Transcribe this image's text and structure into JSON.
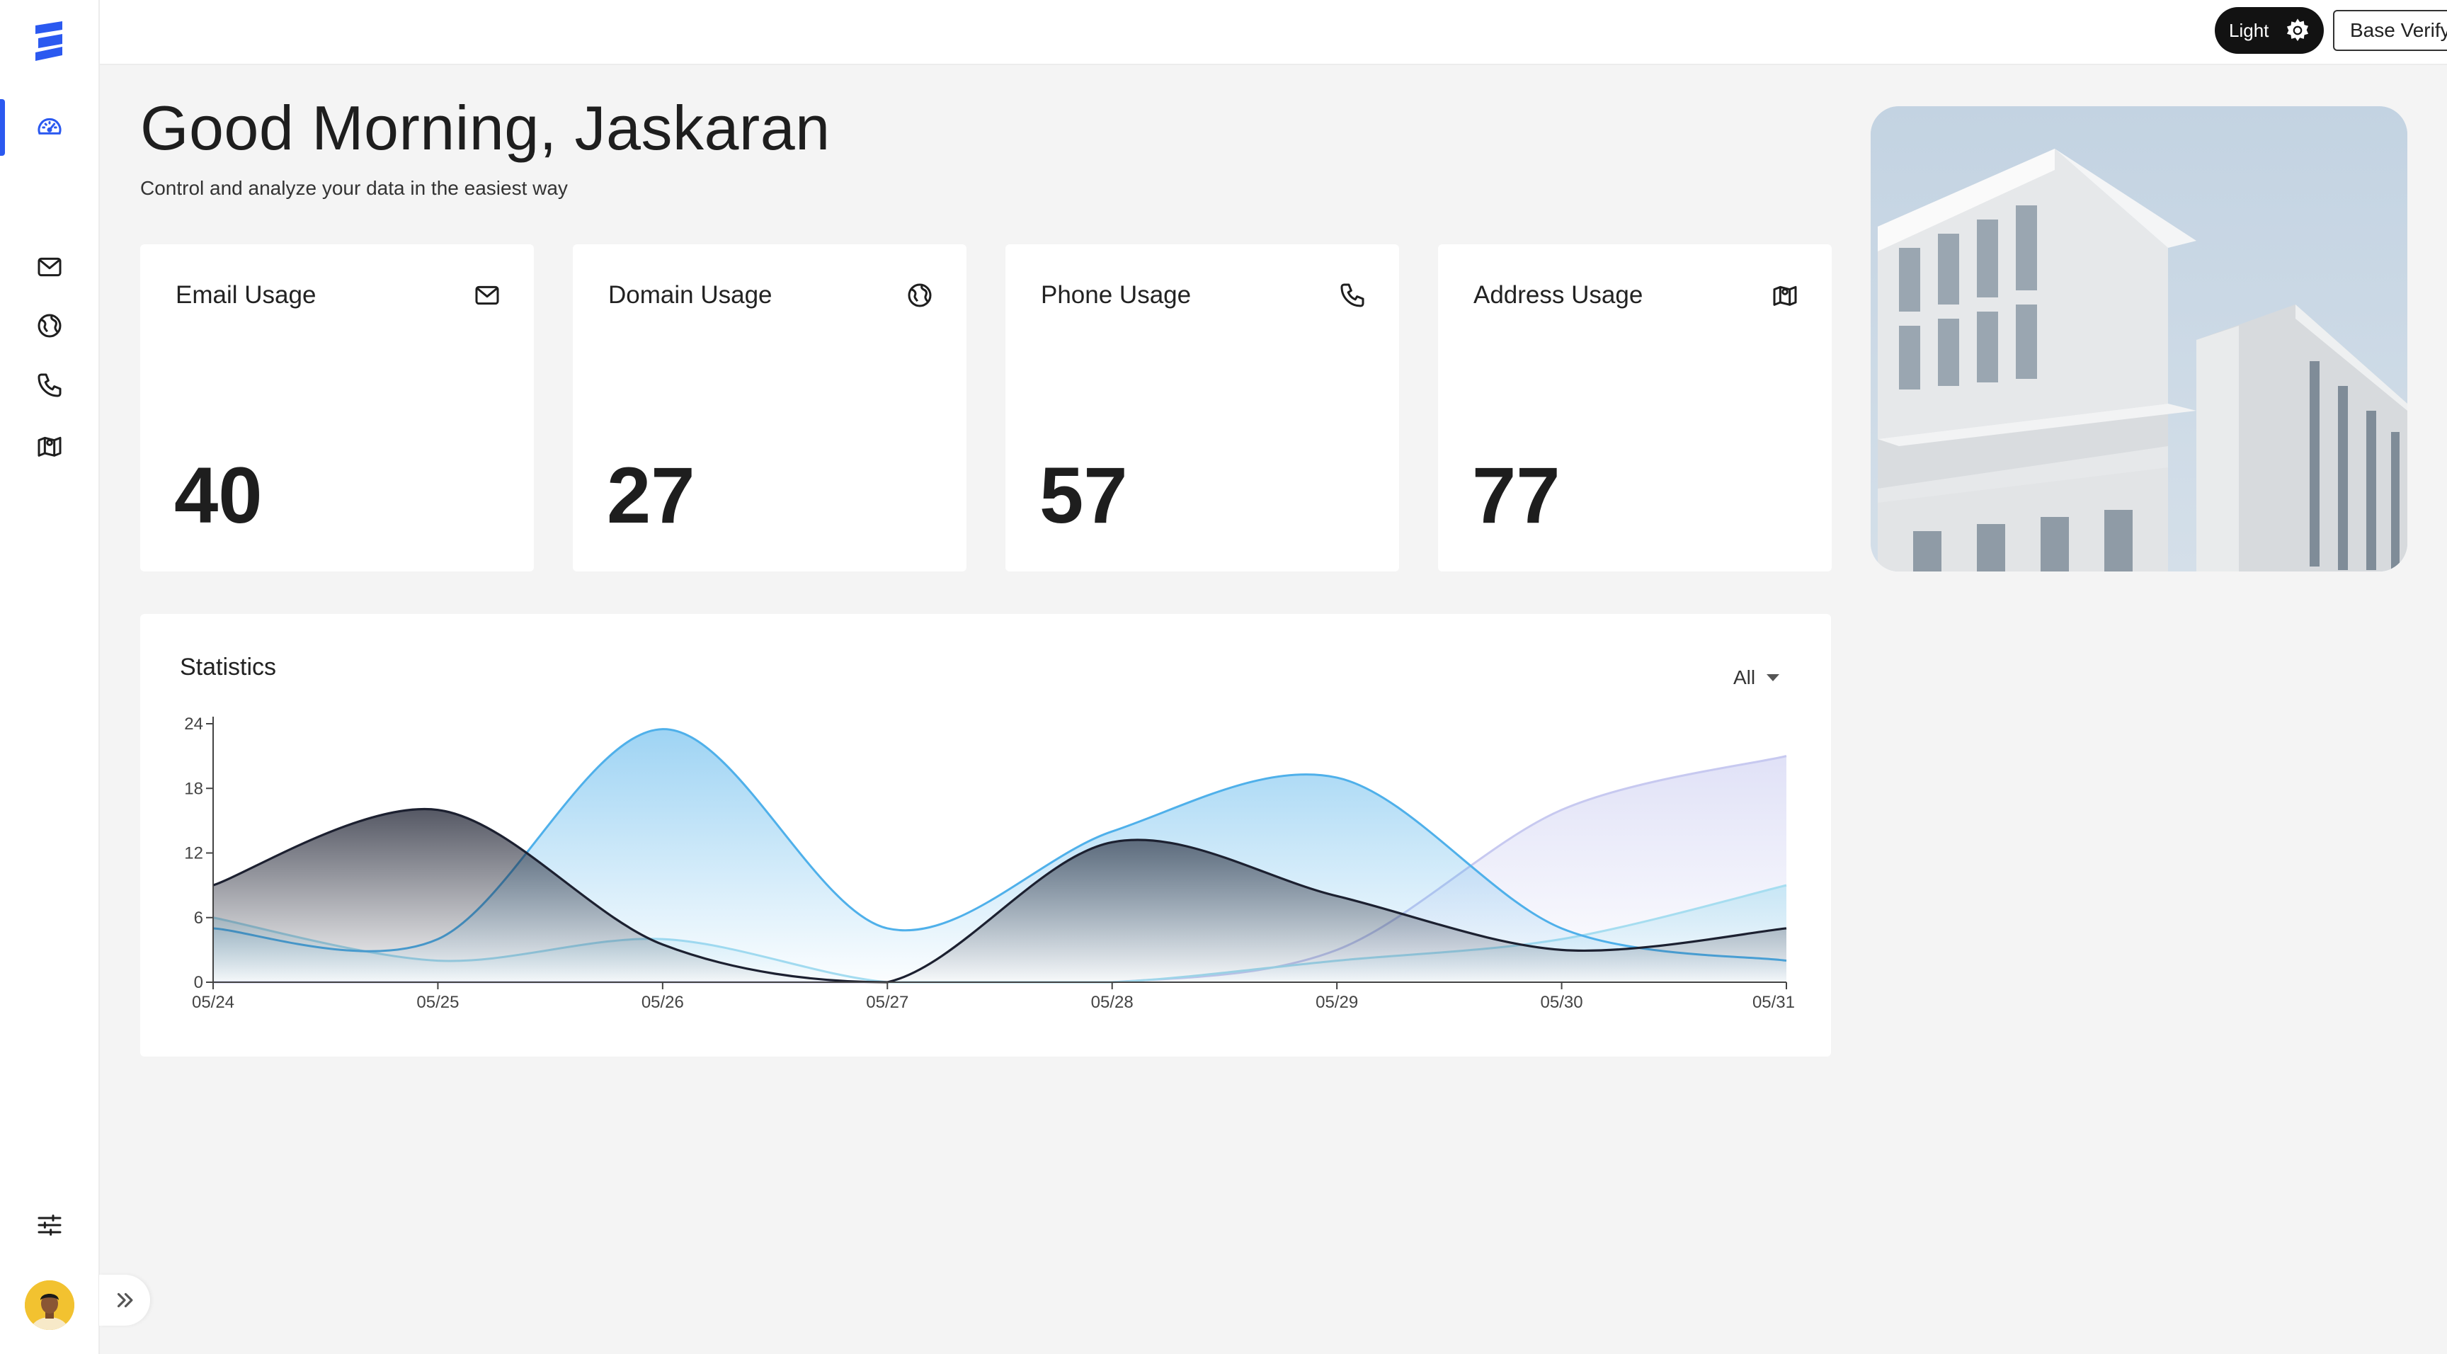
{
  "header": {
    "theme_label": "Light",
    "org_name": "Base Verify Inc"
  },
  "sidebar": {
    "items": [
      {
        "name": "dashboard",
        "icon": "speedometer-icon",
        "active": true
      },
      {
        "name": "email",
        "icon": "mail-icon"
      },
      {
        "name": "domain",
        "icon": "globe-icon"
      },
      {
        "name": "phone",
        "icon": "phone-icon"
      },
      {
        "name": "address",
        "icon": "map-icon"
      }
    ],
    "settings_icon": "sliders-icon",
    "expand_icon": "chevrons-right-icon"
  },
  "main": {
    "greeting": "Good Morning, Jaskaran",
    "subtitle": "Control and analyze your data in the easiest way",
    "cards": [
      {
        "title": "Email Usage",
        "value": "40",
        "icon": "mail-icon"
      },
      {
        "title": "Domain Usage",
        "value": "27",
        "icon": "globe-icon"
      },
      {
        "title": "Phone Usage",
        "value": "57",
        "icon": "phone-icon"
      },
      {
        "title": "Address Usage",
        "value": "77",
        "icon": "map-icon"
      }
    ],
    "statistics": {
      "title": "Statistics",
      "filter_value": "All"
    }
  },
  "colors": {
    "accent": "#2b59f0",
    "dark_series": "#1c2030",
    "blue_series": "#4fb0ea",
    "light_blue_series": "#a6ddf0",
    "lavender_series": "#c7c9f0"
  },
  "chart_data": {
    "type": "area",
    "title": "Statistics",
    "x": [
      "05/24",
      "05/25",
      "05/26",
      "05/27",
      "05/28",
      "05/29",
      "05/30",
      "05/31"
    ],
    "y_ticks": [
      0,
      6,
      12,
      18,
      24
    ],
    "ylim": [
      0,
      24
    ],
    "series": [
      {
        "values": [
          9,
          16,
          3.5,
          0,
          13,
          8,
          3,
          5
        ],
        "color": "#1c2030"
      },
      {
        "values": [
          5,
          4,
          23.5,
          5,
          14,
          19,
          5,
          2
        ],
        "color": "#4fb0ea"
      },
      {
        "values": [
          6,
          2,
          4,
          0,
          0,
          2,
          4,
          9
        ],
        "color": "#a6ddf0"
      },
      {
        "values": [
          0,
          0,
          0,
          0,
          0,
          3,
          16,
          21
        ],
        "color": "#c7c9f0"
      }
    ],
    "grid": false,
    "legend": "none"
  }
}
